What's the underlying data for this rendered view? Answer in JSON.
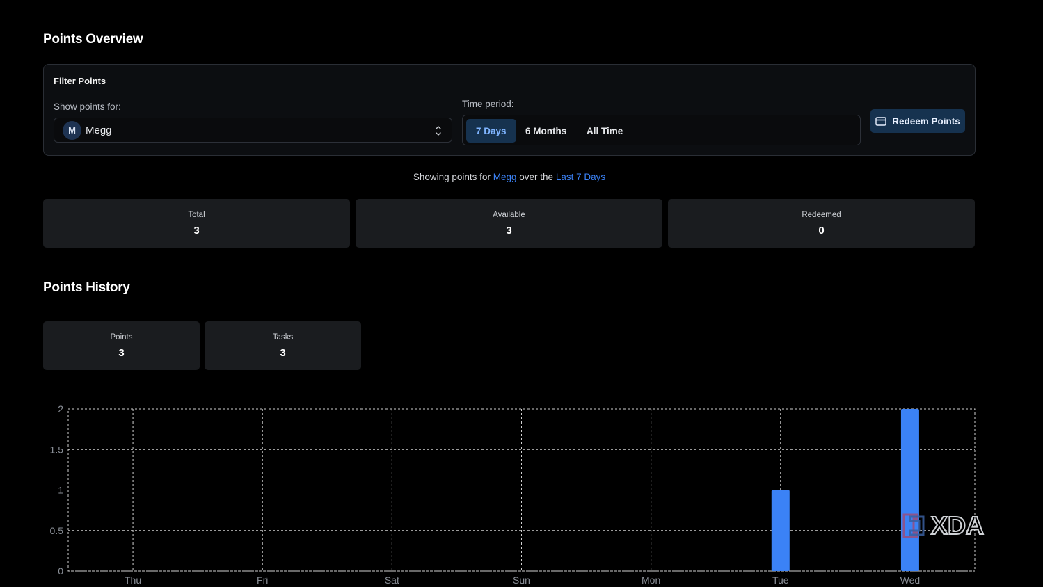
{
  "overview": {
    "title": "Points Overview"
  },
  "filter": {
    "heading": "Filter Points",
    "show_label": "Show points for:",
    "user_initial": "M",
    "user_name": "Megg",
    "time_label": "Time period:",
    "periods": [
      {
        "label": "7 Days",
        "active": true
      },
      {
        "label": "6 Months",
        "active": false
      },
      {
        "label": "All Time",
        "active": false
      }
    ],
    "redeem_label": "Redeem Points"
  },
  "summary": {
    "prefix": "Showing points for",
    "user": "Megg",
    "middle": "over the",
    "period": "Last 7 Days"
  },
  "stats": [
    {
      "label": "Total",
      "value": "3"
    },
    {
      "label": "Available",
      "value": "3"
    },
    {
      "label": "Redeemed",
      "value": "0"
    }
  ],
  "history": {
    "title": "Points History",
    "stats": [
      {
        "label": "Points",
        "value": "3"
      },
      {
        "label": "Tasks",
        "value": "3"
      }
    ]
  },
  "chart_data": {
    "type": "bar",
    "categories": [
      "Thu",
      "Fri",
      "Sat",
      "Sun",
      "Mon",
      "Tue",
      "Wed"
    ],
    "values": [
      0,
      0,
      0,
      0,
      0,
      1,
      2
    ],
    "ylim": [
      0,
      2
    ],
    "yticks": [
      0,
      0.5,
      1,
      1.5,
      2
    ],
    "grid": true,
    "bar_color": "#3b82f6",
    "grid_color": "#d0d0d0"
  },
  "watermark": {
    "text": "XDA"
  },
  "colors": {
    "accent": "#3b82f6",
    "card": "#1a1c1f",
    "active_tab": "#16324f"
  }
}
